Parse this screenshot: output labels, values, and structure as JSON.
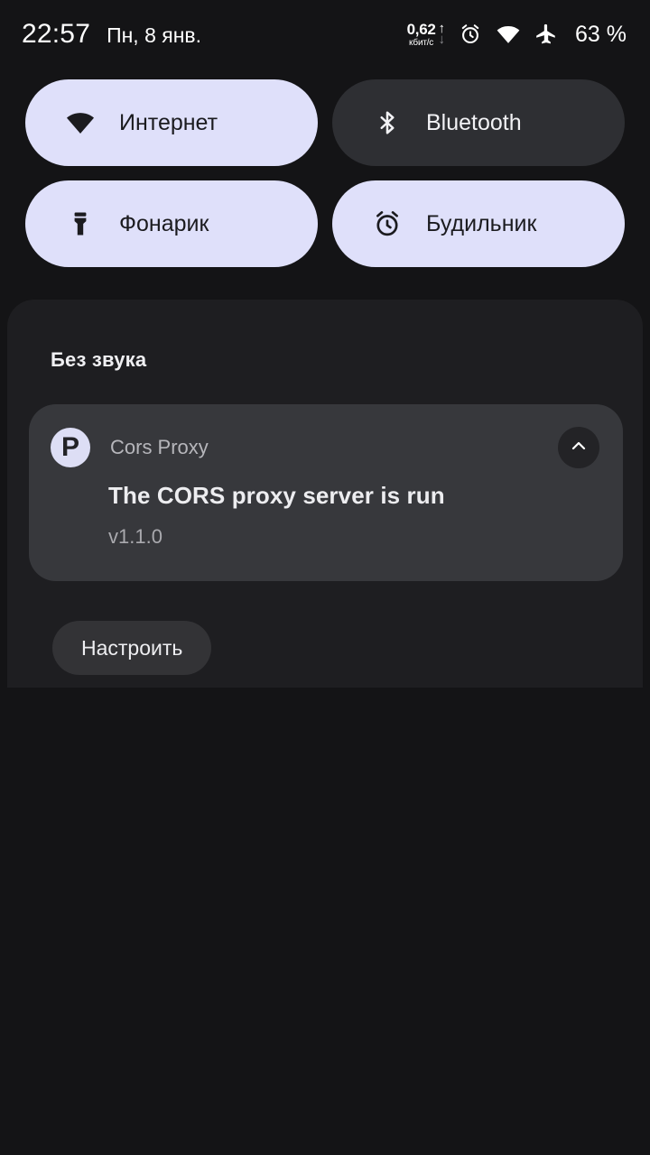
{
  "status_bar": {
    "clock": "22:57",
    "date": "Пн, 8 янв.",
    "network_speed": {
      "value": "0,62",
      "unit": "кбит/с",
      "up_arrow": "↑",
      "down_arrow": "↓"
    },
    "icons": [
      "alarm-icon",
      "wifi-icon",
      "airplane-mode-icon"
    ],
    "battery": "63 %"
  },
  "quick_settings": {
    "tiles": [
      {
        "label": "Интернет",
        "icon": "wifi-icon",
        "state": "on"
      },
      {
        "label": "Bluetooth",
        "icon": "bluetooth-icon",
        "state": "off"
      },
      {
        "label": "Фонарик",
        "icon": "flashlight-icon",
        "state": "on"
      },
      {
        "label": "Будильник",
        "icon": "alarm-clock-icon",
        "state": "on"
      }
    ]
  },
  "notifications": {
    "section_title": "Без звука",
    "items": [
      {
        "app_name": "Cors Proxy",
        "app_icon_letter": "P",
        "title": "The CORS proxy server is run",
        "subtitle": "v1.1.0",
        "collapse_icon": "chevron-up-icon"
      }
    ],
    "manage_button": "Настроить"
  },
  "colors": {
    "page_background": "#141416",
    "tile_active": "#DFE0FA",
    "tile_inactive": "#2E2F33",
    "notification_card": "#37383C",
    "notification_panel": "#1E1E21",
    "manage_button": "#333336",
    "app_icon": "#DDDEF5"
  }
}
